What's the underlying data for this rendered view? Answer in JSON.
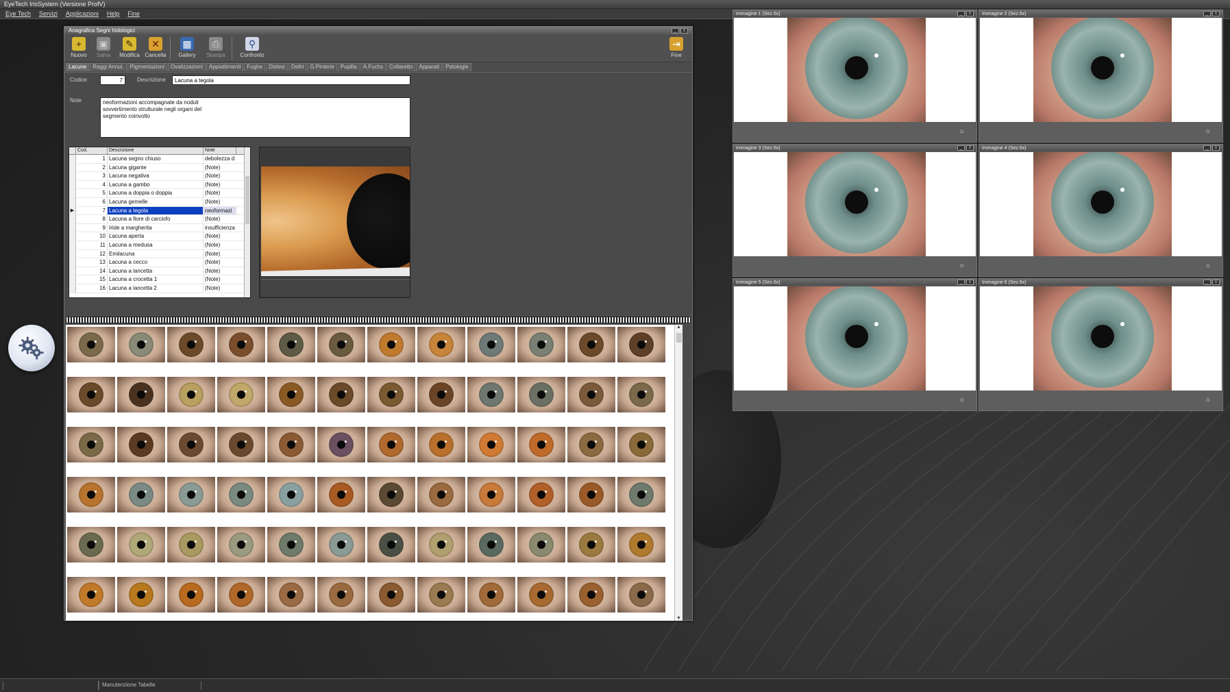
{
  "app": {
    "title": "EyeTech IrisSystem (Versione ProfV)",
    "menu": [
      "Eye Tech",
      "Servizi",
      "Applicazioni",
      "Help",
      "Fine"
    ]
  },
  "window": {
    "title": "Anagrafica Segni Iridologici"
  },
  "toolbar": {
    "nuovo": "Nuovo",
    "salva": "Salva",
    "modifica": "Modifica",
    "cancella": "Cancella",
    "gallery": "Gallery",
    "stampa": "Stampa",
    "confronto": "Confronto",
    "fine": "Fine"
  },
  "tabs": [
    "Lacune",
    "Raggi Annul.",
    "Pigmentazioni",
    "Ovalizzazioni",
    "Appiattimenti",
    "Fughe",
    "Distesi",
    "Delhi",
    "G.Pinterie",
    "Pupilla",
    "A.Fuchs",
    "Collaretto",
    "Apparati",
    "Patologie"
  ],
  "form": {
    "codice_label": "Codice",
    "codice_value": "7",
    "descrizione_label": "Descrizione",
    "descrizione_value": "Lacuna a tegola",
    "note_label": "Note",
    "note_lines": [
      "neoformazioni accompagnate da noduli",
      "sovvertimento strutturale negli organi del",
      "segmento coinvolto"
    ]
  },
  "grid": {
    "headers": [
      "Cod.",
      "Descrizione",
      "Note"
    ],
    "rows": [
      {
        "cod": "1",
        "desc": "Lacuna segno chiuso",
        "note": "debolezza d"
      },
      {
        "cod": "2",
        "desc": "Lacuna gigante",
        "note": "(Note)"
      },
      {
        "cod": "3",
        "desc": "Lacuna negativa",
        "note": "(Note)"
      },
      {
        "cod": "4",
        "desc": "Lacuna a gambo",
        "note": "(Note)"
      },
      {
        "cod": "5",
        "desc": "Lacuna a doppia o doppia",
        "note": "(Note)"
      },
      {
        "cod": "6",
        "desc": "Lacuna gemelle",
        "note": "(Note)"
      },
      {
        "cod": "7",
        "desc": "Lacuna a tegola",
        "note": "neoformazi"
      },
      {
        "cod": "8",
        "desc": "Lacuna a fiore di carciofo",
        "note": "(Note)"
      },
      {
        "cod": "9",
        "desc": "Iride a margherita",
        "note": "insufficienza"
      },
      {
        "cod": "10",
        "desc": "Lacuna aperta",
        "note": "(Note)"
      },
      {
        "cod": "11",
        "desc": "Lacuna a medusa",
        "note": "(Note)"
      },
      {
        "cod": "12",
        "desc": "Emilacuna",
        "note": "(Note)"
      },
      {
        "cod": "13",
        "desc": "Lacuna a cecco",
        "note": "(Note)"
      },
      {
        "cod": "14",
        "desc": "Lacuna a lancetta",
        "note": "(Note)"
      },
      {
        "cod": "15",
        "desc": "Lacuna a crocetta 1",
        "note": "(Note)"
      },
      {
        "cod": "16",
        "desc": "Lacuna a lancetta 2",
        "note": "(Note)"
      }
    ],
    "selected_index": 6
  },
  "panels": [
    {
      "title": "Immagine 1 (Sez.6x)"
    },
    {
      "title": "Immagine 2 (Sez.6x)"
    },
    {
      "title": "Immagine 3 (Sez.6x)"
    },
    {
      "title": "Immagine 4 (Sez.6x)"
    },
    {
      "title": "Immagine 5 (Sez.6x)"
    },
    {
      "title": "Immagine 6 (Sez.6x)"
    }
  ],
  "thumbnails": {
    "count": 72,
    "colors": [
      "#7a6a4a",
      "#8a8a78",
      "#6b4a2a",
      "#7a4e2c",
      "#5d5a46",
      "#6a5a40",
      "#c07a2e",
      "#c8843a",
      "#6e7a78",
      "#7a8074",
      "#6a4a2a",
      "#5e4028",
      "#6a4a2a",
      "#4a3220",
      "#b8a060",
      "#c0a86a",
      "#8a5a24",
      "#6a4a28",
      "#7a5a30",
      "#6a4426",
      "#6e7870",
      "#6a7064",
      "#7a5a3a",
      "#7a6a4a",
      "#7a6a48",
      "#5a3a20",
      "#6a4a30",
      "#6a4a2e",
      "#8a5a34",
      "#6a5060",
      "#b06a2e",
      "#b8702c",
      "#d07a34",
      "#c06a2a",
      "#8a6a40",
      "#8a6a3a",
      "#b8742e",
      "#7a8a84",
      "#8a9a94",
      "#7a8a80",
      "#8aa0a0",
      "#a85a22",
      "#5a4a34",
      "#9a6a40",
      "#c87a3a",
      "#b06028",
      "#9a5a28",
      "#6e7a6c",
      "#6a6a50",
      "#b0a878",
      "#a89a60",
      "#9a9a80",
      "#6e7a6a",
      "#8a9a94",
      "#4a5044",
      "#b0a070",
      "#5a6a60",
      "#8a8a70",
      "#9a7a40",
      "#b07a2e",
      "#c07a2a",
      "#b8781e",
      "#b86a1e",
      "#b0682a",
      "#9a6a44",
      "#9a6a40",
      "#8a5a30",
      "#9a7a50",
      "#a06a3a",
      "#a86a30",
      "#9a6030",
      "#8a6a4a"
    ]
  },
  "status": {
    "cell1": "",
    "cell2": "Manutenzione Tabelle"
  }
}
